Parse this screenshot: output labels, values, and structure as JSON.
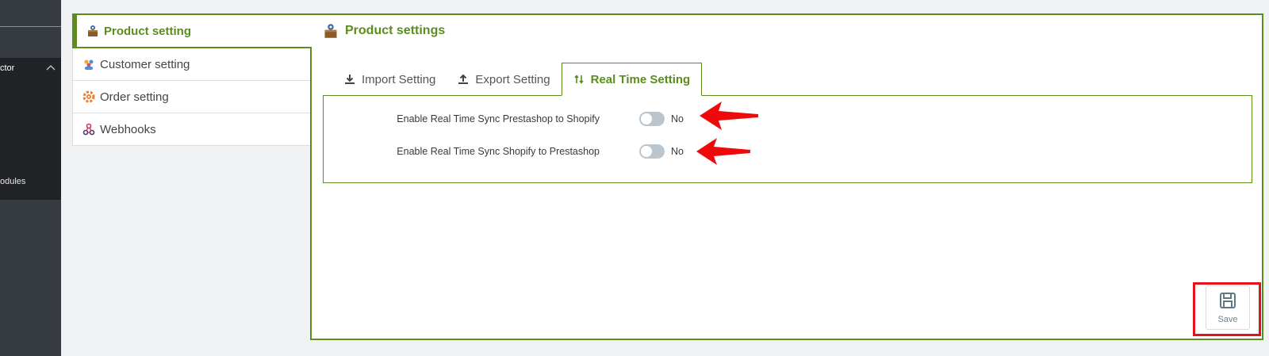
{
  "sidebar": {
    "item_top": "ctor",
    "item_bottom": "odules"
  },
  "left_menu": [
    {
      "label": "Product setting",
      "icon": "product-box-icon"
    },
    {
      "label": "Customer setting",
      "icon": "customers-icon"
    },
    {
      "label": "Order setting",
      "icon": "order-gear-icon"
    },
    {
      "label": "Webhooks",
      "icon": "webhooks-icon"
    }
  ],
  "header": {
    "title": "Product settings",
    "icon": "product-box-icon"
  },
  "tabs": [
    {
      "label": "Import Setting",
      "icon": "download-icon"
    },
    {
      "label": "Export Setting",
      "icon": "upload-icon"
    },
    {
      "label": "Real Time Setting",
      "icon": "sync-arrows-icon",
      "active": true
    }
  ],
  "settings": [
    {
      "label": "Enable Real Time Sync Prestashop to Shopify",
      "value": "No",
      "enabled": false
    },
    {
      "label": "Enable Real Time Sync Shopify to Prestashop",
      "value": "No",
      "enabled": false
    }
  ],
  "save_button": {
    "label": "Save",
    "icon": "floppy-disk-icon"
  },
  "colors": {
    "accent": "#5a8d1e",
    "sidebar": "#363a41",
    "annotation_red": "#e2131b"
  }
}
